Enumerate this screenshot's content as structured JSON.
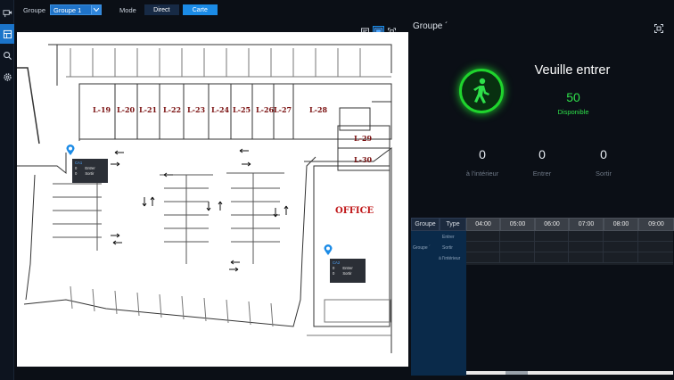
{
  "topbar": {
    "group_label": "Groupe",
    "group_selected": "Groupe 1",
    "mode_label": "Mode",
    "mode_direct": "Direct",
    "mode_carte": "Carte"
  },
  "map": {
    "slots_top": [
      "L-19",
      "L-20",
      "L-21",
      "L-22",
      "L-23",
      "L-24",
      "L-25",
      "L-26",
      "L-27",
      "L-28"
    ],
    "slot_29": "L-29",
    "slot_30": "L-30",
    "office": "OFFICE",
    "cam1": {
      "title": "CA1",
      "entrer_count": "0",
      "entrer": "Entrer",
      "sortir_count": "0",
      "sortir": "Sortir"
    },
    "cam2": {
      "title": "CA2",
      "entrer_count": "0",
      "entrer": "Entrer",
      "sortir_count": "0",
      "sortir": "Sortir"
    }
  },
  "panel": {
    "title": "Groupe ´",
    "status": "Veuille entrer",
    "available_count": "50",
    "available_label": "Disponible",
    "counters": [
      {
        "value": "0",
        "label": "à l'intérieur"
      },
      {
        "value": "0",
        "label": "Entrer"
      },
      {
        "value": "0",
        "label": "Sortir"
      }
    ],
    "table": {
      "col_group": "Groupe",
      "col_type": "Type",
      "times": [
        "04:00",
        "05:00",
        "06:00",
        "07:00",
        "08:00",
        "09:00"
      ],
      "group_row_label": "Groupe ´",
      "types": [
        "Entrer",
        "Sortir",
        "à l'intérieur"
      ]
    }
  },
  "colors": {
    "accent": "#1b8be6",
    "available": "#2ee04a",
    "status_ring": "#1fd42d"
  },
  "icons": {
    "rail": [
      "camera-icon",
      "map-icon",
      "search-icon",
      "settings-icon"
    ],
    "status": "walking-person-icon"
  }
}
